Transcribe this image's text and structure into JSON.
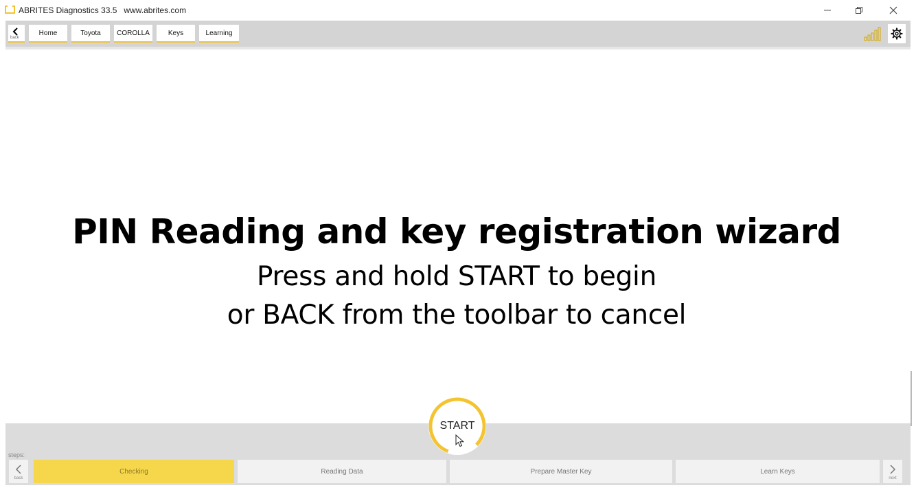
{
  "window": {
    "title": "ABRITES Diagnostics 33.5   www.abrites.com",
    "controls": [
      "minimize-icon",
      "restore-icon",
      "close-icon"
    ]
  },
  "toolbar": {
    "back_label": "back",
    "breadcrumbs": [
      "Home",
      "Toyota",
      "COROLLA",
      "Keys",
      "Learning"
    ],
    "icons": [
      "signal-strength-icon",
      "gear-icon"
    ]
  },
  "main": {
    "title": "PIN Reading and key registration wizard",
    "line1": "Press and hold START to begin",
    "line2": "or BACK from the toolbar to cancel"
  },
  "footer": {
    "start_label": "START",
    "steps_label": "steps:",
    "prev_label": "back",
    "next_label": "next",
    "steps": [
      "Checking",
      "Reading Data",
      "Prepare Master Key",
      "Learn Keys"
    ],
    "active_step": "Checking"
  },
  "colors": {
    "accent": "#f4c430",
    "active_step": "#f6d64b",
    "toolbar_bg": "#d4d4d4",
    "footer_bg": "#dcdcdc"
  }
}
